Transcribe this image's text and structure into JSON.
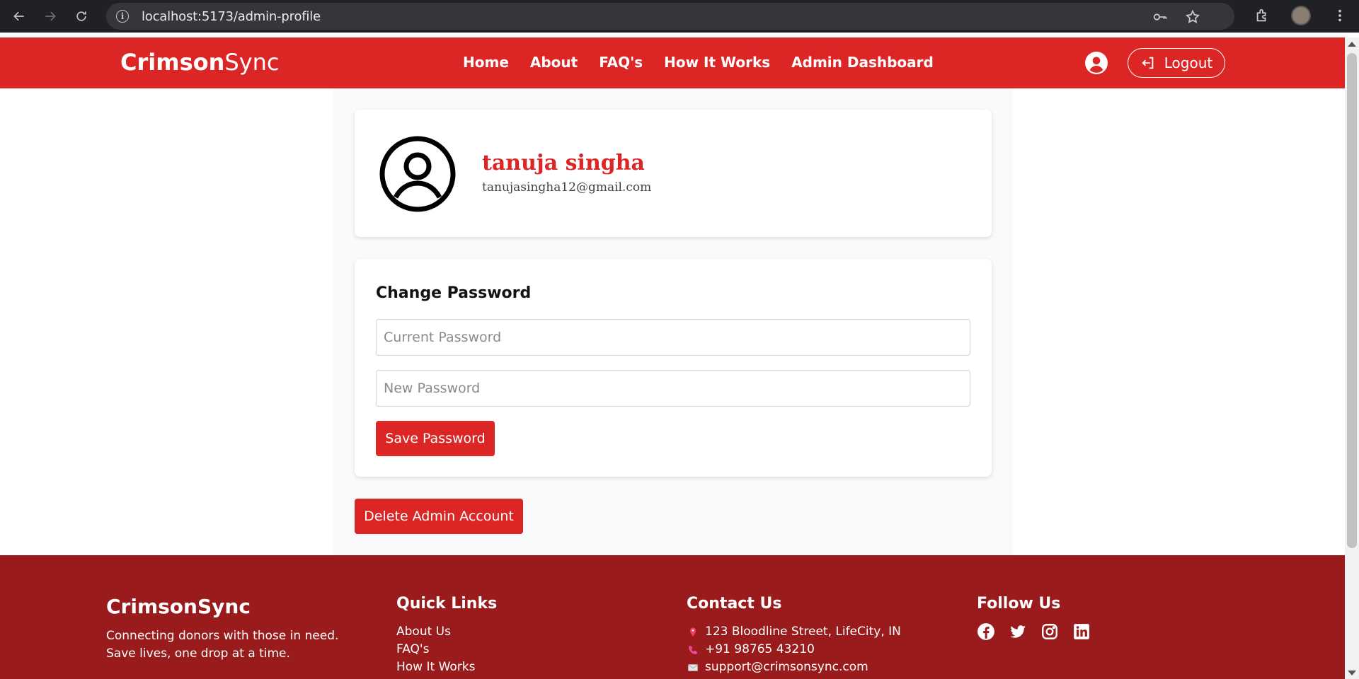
{
  "browser": {
    "url": "localhost:5173/admin-profile"
  },
  "header": {
    "brand_bold": "Crimson",
    "brand_light": "Sync",
    "nav": [
      "Home",
      "About",
      "FAQ's",
      "How It Works",
      "Admin Dashboard"
    ],
    "logout_label": "Logout"
  },
  "profile": {
    "name": "tanuja singha",
    "email": "tanujasingha12@gmail.com"
  },
  "password": {
    "title": "Change Password",
    "current_placeholder": "Current Password",
    "new_placeholder": "New Password",
    "save_label": "Save Password"
  },
  "delete_label": "Delete Admin Account",
  "footer": {
    "brand": "CrimsonSync",
    "tagline": "Connecting donors with those in need. Save lives, one drop at a time.",
    "quick_links_title": "Quick Links",
    "quick_links": [
      "About Us",
      "FAQ's",
      "How It Works"
    ],
    "contact_title": "Contact Us",
    "contact": [
      {
        "icon": "pin-icon",
        "text": "123 Bloodline Street, LifeCity, IN"
      },
      {
        "icon": "phone-icon",
        "text": "+91 98765 43210"
      },
      {
        "icon": "envelope-icon",
        "text": "support@crimsonsync.com"
      }
    ],
    "follow_title": "Follow Us",
    "socials": [
      "facebook-icon",
      "twitter-icon",
      "instagram-icon",
      "linkedin-icon"
    ]
  },
  "colors": {
    "header_red": "#dc2626",
    "footer_red": "#991b1b",
    "button_red": "#dc2626"
  }
}
